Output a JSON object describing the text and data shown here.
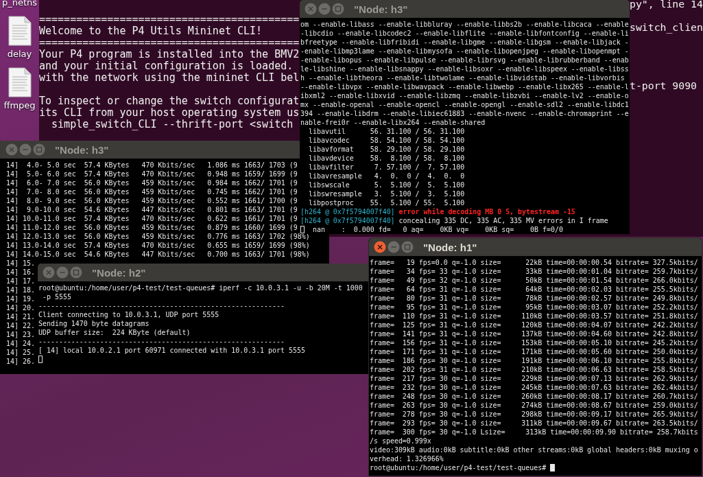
{
  "desktop_icons": [
    {
      "label": "p_netns",
      "icon_visible": false
    },
    {
      "label": "delay",
      "icon_visible": true
    },
    {
      "label": "ffmpeg",
      "icon_visible": true
    }
  ],
  "background_terminal": {
    "lines": [
      {
        "text": "=========================================="
      },
      {
        "text": "Welcome to the P4 Utils Mininet CLI!"
      },
      {
        "text": "=========================================="
      },
      {
        "text": "Your P4 program is installed into the BMV2"
      },
      {
        "text": "and your initial configuration is loaded."
      },
      {
        "text": "with the network using the mininet CLI bel"
      },
      {
        "text": "To inspect or change the switch configurat",
        "gap_before": true
      },
      {
        "text": "its CLI from your host operating system us"
      },
      {
        "text": "  simple_switch_CLI --thrift-port <switch"
      }
    ],
    "right_fragments": [
      "py\", line 14",
      "switch_clien",
      "t-port 9090"
    ]
  },
  "windows": [
    {
      "title": "\"Node: h3\"",
      "focused": false,
      "lines": [
        {
          "text": "om --enable-libass --enable-libbluray --enable-libbs2b --enable-libcaca --enable"
        },
        {
          "text": "-libcdio --enable-libcodec2 --enable-libflite --enable-libfontconfig --enable-li"
        },
        {
          "text": "bfreetype --enable-libfribidi --enable-libgme --enable-libgsm --enable-libjack -"
        },
        {
          "text": "-enable-libmp3lame --enable-libmysofa --enable-libopenjpeg --enable-libopenmpt -"
        },
        {
          "text": "-enable-libopus --enable-libpulse --enable-librsvg --enable-librubberband --enab"
        },
        {
          "text": "le-libshine --enable-libsnappy --enable-libsoxr --enable-libspeex --enable-libss"
        },
        {
          "text": "h --enable-libtheora --enable-libtwolame --enable-libvidstab --enable-libvorbis"
        },
        {
          "text": "--enable-libvpx --enable-libwavpack --enable-libwebp --enable-libx265 --enable-l"
        },
        {
          "text": "ibxml2 --enable-libxvid --enable-libzmq --enable-libzvbi --enable-lv2 --enable-o"
        },
        {
          "text": "mx --enable-openal --enable-opencl --enable-opengl --enable-sdl2 --enable-libdc1"
        },
        {
          "text": "394 --enable-libdrm --enable-libiec61883 --enable-nvenc --enable-chromaprint --e"
        },
        {
          "text": "nable-frei0r --enable-libx264 --enable-shared"
        },
        {
          "text": "  libavutil      56. 31.100 / 56. 31.100"
        },
        {
          "text": "  libavcodec     58. 54.100 / 58. 54.100"
        },
        {
          "text": "  libavformat    58. 29.100 / 58. 29.100"
        },
        {
          "text": "  libavdevice    58.  8.100 / 58.  8.100"
        },
        {
          "text": "  libavfilter     7. 57.100 /  7. 57.100"
        },
        {
          "text": "  libavresample   4.  0.  0 /  4.  0.  0"
        },
        {
          "text": "  libswscale      5.  5.100 /  5.  5.100"
        },
        {
          "text": "  libswresample   3.  5.100 /  3.  5.100"
        },
        {
          "text": "  libpostproc    55.  5.100 / 55.  5.100"
        },
        {
          "segments": [
            {
              "text": "[h264 @ 0x7f5794007f40]",
              "kind": "source"
            },
            {
              "text": " error while decoding MB 0 5, bytestream -15",
              "kind": "error"
            }
          ]
        },
        {
          "segments": [
            {
              "text": "[h264 @ 0x7f5794007f40]",
              "kind": "source"
            },
            {
              "text": " concealing 335 DC, 335 AC, 335 MV errors in I frame",
              "kind": "message"
            }
          ]
        },
        {
          "cursor_before": true,
          "text": "  nan    :  0.000 fd=   0 aq=    0KB vq=    0KB sq=    0B f=0/0"
        }
      ]
    },
    {
      "title": "\"Node: h3\"",
      "focused": false,
      "lines": [
        {
          "text": " 14]  4.0- 5.0 sec  57.4 KBytes   470 Kbits/sec   1.086 ms 1663/ 1703 (9"
        },
        {
          "text": " 14]  5.0- 6.0 sec  57.4 KBytes   470 Kbits/sec   0.948 ms 1659/ 1699 (9"
        },
        {
          "text": " 14]  6.0- 7.0 sec  56.0 KBytes   459 Kbits/sec   0.984 ms 1662/ 1701 (9"
        },
        {
          "text": " 14]  7.0- 8.0 sec  56.0 KBytes   459 Kbits/sec   0.745 ms 1662/ 1701 (9"
        },
        {
          "text": " 14]  8.0- 9.0 sec  56.0 KBytes   459 Kbits/sec   0.552 ms 1661/ 1700 (9"
        },
        {
          "text": " 14]  9.0-10.0 sec  54.6 KBytes   447 Kbits/sec   0.801 ms 1663/ 1701 (9"
        },
        {
          "text": " 14] 10.0-11.0 sec  57.4 KBytes   470 Kbits/sec   0.622 ms 1661/ 1701 (9"
        },
        {
          "text": " 14] 11.0-12.0 sec  56.0 KBytes   459 Kbits/sec   0.879 ms 1660/ 1699 (9"
        },
        {
          "text": " 14] 12.0-13.0 sec  56.0 KBytes   459 Kbits/sec   0.776 ms 1663/ 1702 (98%)"
        },
        {
          "text": " 14] 13.0-14.0 sec  57.4 KBytes   470 Kbits/sec   0.655 ms 1659/ 1699 (98%)"
        },
        {
          "text": " 14] 14.0-15.0 sec  54.6 KBytes   447 Kbits/sec   0.700 ms 1663/ 1701 (98%)"
        },
        {
          "text": " 14] 15."
        },
        {
          "text": " 14] 16."
        },
        {
          "text": " 14] 17."
        },
        {
          "text": " 14] 18."
        },
        {
          "text": " 14] 19."
        },
        {
          "text": " 14] 20."
        },
        {
          "text": " 14] 21."
        },
        {
          "text": " 14] 22."
        },
        {
          "text": " 14] 23."
        },
        {
          "text": " 14] 24."
        },
        {
          "text": " 14] 25."
        },
        {
          "text": " 14] 26."
        }
      ]
    },
    {
      "title": "\"Node: h2\"",
      "focused": false,
      "lines": [
        {
          "text": "root@ubuntu:/home/user/p4-test/test-queues# iperf -c 10.0.3.1 -u -b 20M -t 1000"
        },
        {
          "text": " -p 5555"
        },
        {
          "text": "------------------------------------------------------------"
        },
        {
          "text": "Client connecting to 10.0.3.1, UDP port 5555"
        },
        {
          "text": "Sending 1470 byte datagrams"
        },
        {
          "text": "UDP buffer size:  224 KByte (default)"
        },
        {
          "text": "------------------------------------------------------------"
        },
        {
          "text": "[ 14] local 10.0.2.1 port 60971 connected with 10.0.3.1 port 5555"
        },
        {
          "cursor_before": true
        }
      ]
    },
    {
      "title": "\"Node: h1\"",
      "focused": true,
      "lines": [
        {
          "text": "frame=   19 fps=0.0 q=-1.0 size=      22kB time=00:00:00.54 bitrate= 327.5kbits/"
        },
        {
          "text": "frame=   34 fps= 33 q=-1.0 size=      33kB time=00:00:01.04 bitrate= 259.7kbits/"
        },
        {
          "text": "frame=   49 fps= 32 q=-1.0 size=      50kB time=00:00:01.54 bitrate= 266.0kbits/"
        },
        {
          "text": "frame=   64 fps= 31 q=-1.0 size=      64kB time=00:00:02.03 bitrate= 255.5kbits/"
        },
        {
          "text": "frame=   80 fps= 31 q=-1.0 size=      78kB time=00:00:02.57 bitrate= 249.8kbits/"
        },
        {
          "text": "frame=   95 fps= 31 q=-1.0 size=      95kB time=00:00:03.07 bitrate= 252.2kbits/"
        },
        {
          "text": "frame=  110 fps= 31 q=-1.0 size=     110kB time=00:00:03.57 bitrate= 251.8kbits/"
        },
        {
          "text": "frame=  125 fps= 31 q=-1.0 size=     120kB time=00:00:04.07 bitrate= 242.2kbits/"
        },
        {
          "text": "frame=  141 fps= 31 q=-1.0 size=     137kB time=00:00:04.60 bitrate= 242.8kbits/"
        },
        {
          "text": "frame=  156 fps= 31 q=-1.0 size=     153kB time=00:00:05.10 bitrate= 245.2kbits/"
        },
        {
          "text": "frame=  171 fps= 31 q=-1.0 size=     171kB time=00:00:05.60 bitrate= 250.0kbits/"
        },
        {
          "text": "frame=  186 fps= 30 q=-1.0 size=     191kB time=00:00:06.10 bitrate= 255.8kbits/"
        },
        {
          "text": "frame=  202 fps= 31 q=-1.0 size=     210kB time=00:00:06.63 bitrate= 258.5kbits/"
        },
        {
          "text": "frame=  217 fps= 30 q=-1.0 size=     229kB time=00:00:07.13 bitrate= 262.9kbits/"
        },
        {
          "text": "frame=  232 fps= 30 q=-1.0 size=     245kB time=00:00:07.63 bitrate= 262.4kbits/"
        },
        {
          "text": "frame=  248 fps= 30 q=-1.0 size=     260kB time=00:00:08.17 bitrate= 260.7kbits/"
        },
        {
          "text": "frame=  263 fps= 30 q=-1.0 size=     274kB time=00:00:08.67 bitrate= 259.0kbits/"
        },
        {
          "text": "frame=  278 fps= 30 q=-1.0 size=     298kB time=00:00:09.17 bitrate= 265.9kbits/"
        },
        {
          "text": "frame=  293 fps= 30 q=-1.0 size=     311kB time=00:00:09.67 bitrate= 263.5kbits/"
        },
        {
          "text": "frame=  300 fps= 30 q=-1.0 Lsize=     313kB time=00:00:09.90 bitrate= 258.7kbits"
        },
        {
          "text": "/s speed=0.999x"
        },
        {
          "text": "video:309kB audio:0kB subtitle:0kB other streams:0kB global headers:0kB muxing o"
        },
        {
          "text": "verhead: 1.326966%"
        },
        {
          "text": "root@ubuntu:/home/user/p4-test/test-queues# ",
          "cursor_after": true
        }
      ]
    }
  ]
}
